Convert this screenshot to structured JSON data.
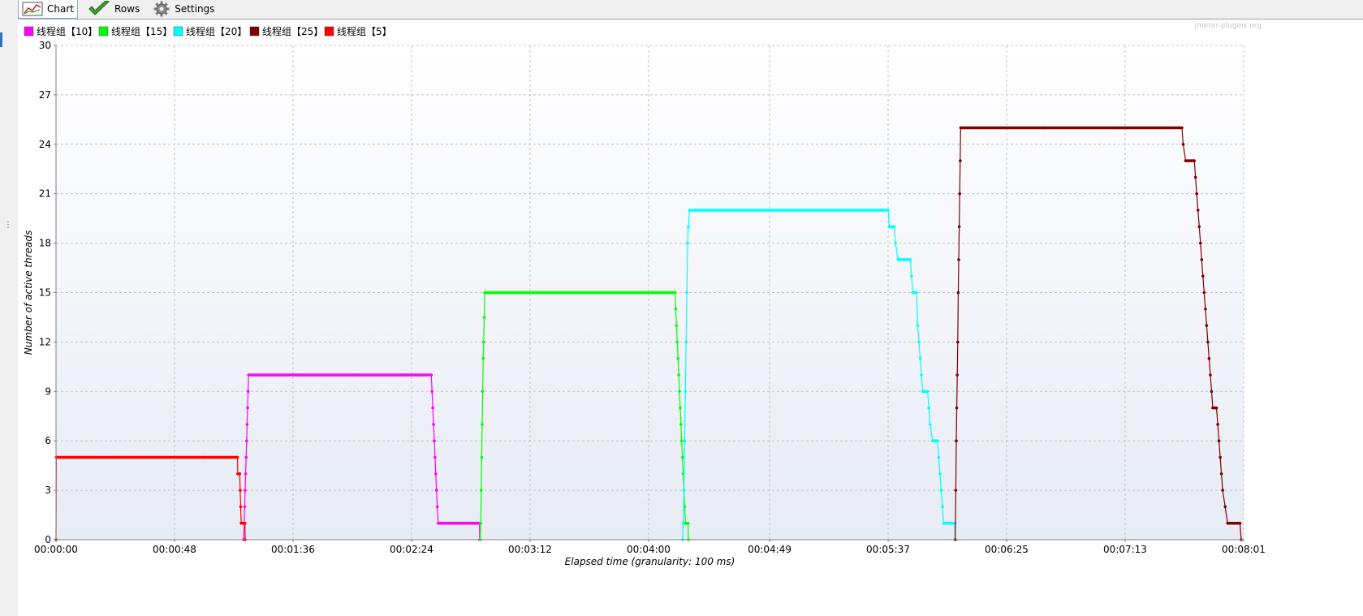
{
  "toolbar": {
    "chart_label": "Chart",
    "rows_label": "Rows",
    "settings_label": "Settings"
  },
  "watermark": "jmeter-plugins.org",
  "chart_data": {
    "type": "line",
    "title": "",
    "xlabel": "Elapsed time (granularity: 100 ms)",
    "ylabel": "Number of active threads",
    "x_unit": "seconds",
    "xlim": [
      0,
      481
    ],
    "ylim": [
      0,
      30
    ],
    "y_ticks": [
      0,
      3,
      6,
      9,
      12,
      15,
      18,
      21,
      24,
      27,
      30
    ],
    "x_ticks": [
      0,
      48,
      96,
      144,
      192,
      240,
      289,
      337,
      385,
      433,
      481
    ],
    "x_tick_labels": [
      "00:00:00",
      "00:00:48",
      "00:01:36",
      "00:02:24",
      "00:03:12",
      "00:04:00",
      "00:04:49",
      "00:05:37",
      "00:06:25",
      "00:07:13",
      "00:08:01"
    ],
    "grid": true,
    "legend_position": "top-left",
    "series": [
      {
        "name": "线程组【10】",
        "color": "#ff00ff",
        "points": [
          [
            76.0,
            0
          ],
          [
            76.2,
            1
          ],
          [
            76.4,
            2
          ],
          [
            76.6,
            3
          ],
          [
            76.8,
            4
          ],
          [
            77.0,
            5
          ],
          [
            77.2,
            6
          ],
          [
            77.4,
            7
          ],
          [
            77.6,
            8
          ],
          [
            77.8,
            9
          ],
          [
            78.0,
            10
          ],
          [
            100,
            10
          ],
          [
            120,
            10
          ],
          [
            140,
            10
          ],
          [
            152.0,
            10
          ],
          [
            152.3,
            9
          ],
          [
            152.6,
            8
          ],
          [
            152.9,
            7
          ],
          [
            153.2,
            6
          ],
          [
            153.5,
            5
          ],
          [
            153.8,
            4
          ],
          [
            154.1,
            3
          ],
          [
            154.4,
            2
          ],
          [
            154.8,
            1
          ],
          [
            165,
            1
          ],
          [
            171.5,
            1
          ],
          [
            171.6,
            0
          ]
        ]
      },
      {
        "name": "线程组【15】",
        "color": "#00ff00",
        "points": [
          [
            171.8,
            0
          ],
          [
            172.0,
            1
          ],
          [
            172.2,
            3
          ],
          [
            172.4,
            5
          ],
          [
            172.6,
            7
          ],
          [
            172.8,
            9
          ],
          [
            173.0,
            11
          ],
          [
            173.2,
            12
          ],
          [
            173.4,
            13.5
          ],
          [
            173.6,
            15
          ],
          [
            200,
            15
          ],
          [
            230,
            15
          ],
          [
            250.8,
            15
          ],
          [
            251.0,
            14
          ],
          [
            251.3,
            13
          ],
          [
            251.6,
            12
          ],
          [
            251.9,
            11
          ],
          [
            252.2,
            10
          ],
          [
            252.5,
            9
          ],
          [
            252.8,
            8
          ],
          [
            253.1,
            7
          ],
          [
            253.4,
            6
          ],
          [
            253.7,
            5
          ],
          [
            254.0,
            4
          ],
          [
            254.3,
            3
          ],
          [
            254.6,
            2
          ],
          [
            254.9,
            1
          ],
          [
            256.0,
            1
          ],
          [
            256.1,
            0
          ]
        ]
      },
      {
        "name": "线程组【20】",
        "color": "#00ffff",
        "points": [
          [
            253.8,
            0
          ],
          [
            254.0,
            1
          ],
          [
            254.3,
            3
          ],
          [
            254.6,
            6
          ],
          [
            254.9,
            9
          ],
          [
            255.2,
            12
          ],
          [
            255.5,
            15
          ],
          [
            255.8,
            18
          ],
          [
            256.1,
            19
          ],
          [
            256.6,
            20
          ],
          [
            280,
            20
          ],
          [
            320,
            20
          ],
          [
            337.0,
            20
          ],
          [
            337.5,
            19
          ],
          [
            339.5,
            19
          ],
          [
            340.0,
            18
          ],
          [
            341.0,
            17
          ],
          [
            346.0,
            17
          ],
          [
            346.5,
            16
          ],
          [
            347.0,
            15
          ],
          [
            348.5,
            15
          ],
          [
            349.0,
            13
          ],
          [
            349.5,
            12
          ],
          [
            350.0,
            11
          ],
          [
            350.5,
            10
          ],
          [
            351.0,
            9
          ],
          [
            353.0,
            9
          ],
          [
            353.5,
            8
          ],
          [
            354.0,
            7
          ],
          [
            355.0,
            6
          ],
          [
            357.0,
            6
          ],
          [
            357.5,
            5
          ],
          [
            358.0,
            4
          ],
          [
            358.5,
            3
          ],
          [
            359.0,
            2
          ],
          [
            359.5,
            1
          ],
          [
            364.0,
            1
          ],
          [
            364.1,
            0
          ]
        ]
      },
      {
        "name": "线程组【25】",
        "color": "#800000",
        "points": [
          [
            364.2,
            0
          ],
          [
            364.4,
            3
          ],
          [
            364.6,
            6
          ],
          [
            364.8,
            8
          ],
          [
            365.0,
            10
          ],
          [
            365.2,
            12
          ],
          [
            365.4,
            15
          ],
          [
            365.6,
            17
          ],
          [
            365.8,
            19
          ],
          [
            366.0,
            21
          ],
          [
            366.2,
            23
          ],
          [
            366.4,
            25
          ],
          [
            400,
            25
          ],
          [
            430,
            25
          ],
          [
            456.0,
            25
          ],
          [
            456.5,
            24
          ],
          [
            457.5,
            23
          ],
          [
            461.0,
            23
          ],
          [
            461.5,
            22
          ],
          [
            462.0,
            21
          ],
          [
            462.5,
            20
          ],
          [
            463.0,
            19
          ],
          [
            463.5,
            18
          ],
          [
            464.0,
            17
          ],
          [
            464.5,
            16
          ],
          [
            465.0,
            15
          ],
          [
            465.5,
            14
          ],
          [
            466.0,
            13
          ],
          [
            466.5,
            12
          ],
          [
            467.0,
            11
          ],
          [
            467.5,
            10
          ],
          [
            468.0,
            9
          ],
          [
            468.5,
            8
          ],
          [
            470.0,
            8
          ],
          [
            470.5,
            7
          ],
          [
            471.0,
            6
          ],
          [
            471.5,
            5
          ],
          [
            472.0,
            4
          ],
          [
            472.5,
            3
          ],
          [
            473.5,
            2
          ],
          [
            474.5,
            1
          ],
          [
            479.5,
            1
          ],
          [
            480.0,
            0
          ]
        ]
      },
      {
        "name": "线程组【5】",
        "color": "#ff0000",
        "points": [
          [
            0.0,
            0
          ],
          [
            0.1,
            5
          ],
          [
            30,
            5
          ],
          [
            60,
            5
          ],
          [
            73.5,
            5
          ],
          [
            73.6,
            4
          ],
          [
            74.4,
            4
          ],
          [
            74.6,
            3
          ],
          [
            74.8,
            2
          ],
          [
            75.0,
            1
          ],
          [
            76.5,
            1
          ],
          [
            76.6,
            0
          ]
        ]
      }
    ]
  }
}
